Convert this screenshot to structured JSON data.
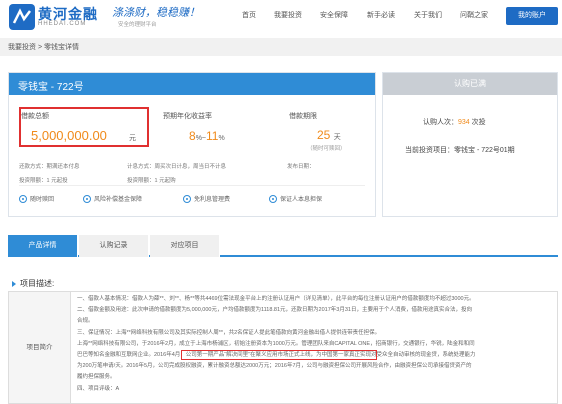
{
  "header": {
    "logo_cn": "黄河金融",
    "logo_en": "HHEDAI.COM",
    "slogan": "涤涤财，稳稳赚！",
    "slogan_sub": "安全的理财平台",
    "nav": [
      "首页",
      "我要投资",
      "安全保障",
      "新手必读",
      "关于我们",
      "问鞘之家"
    ],
    "account_button": "我的账户"
  },
  "breadcrumb": "我要投资 > 零钱宝详情",
  "product": {
    "title": "零钱宝 - 722号",
    "amount_label": "借款总额",
    "amount": "5,000,000.00",
    "amount_unit": "元",
    "rate_label": "预期年化收益率",
    "rate_min": "8",
    "rate_max": "11",
    "rate_sep": "%~",
    "rate_unit": "%",
    "term_label": "借款期限",
    "term_value": "25",
    "term_unit": "天",
    "term_note": "（随时可赎回）",
    "meta": {
      "return_method": "还款方式：期满还本付息",
      "interest_method": "计息方式：周买次日计息，周当日不计息",
      "publish_time": "发布日期：",
      "min_invest": "投资限额：1 元起投",
      "invest_limit": "投资限额：1 元起购"
    },
    "features": [
      "随时赎回",
      "风险补偿基金保障",
      "免利息管理费",
      "保证人本息担保"
    ]
  },
  "side_panel": {
    "status": "认购已满",
    "buyers_prefix": "认购人次：",
    "buyers_count": "934",
    "buyers_suffix": " 次投",
    "project_line": "当前投资项目：零钱宝 - 722号01期"
  },
  "tabs": [
    "产品详情",
    "认购记录",
    "对应项目"
  ],
  "description": {
    "title": "项目描述:",
    "label": "项目简介",
    "lines": [
      "一、借款人基本情况：借款人为薛**、刘**、杨**等共4469位需法现金平台上的注册认证用户（详见清单），此平台的每位注册认证用户的借款额度均不超过3000元。",
      "二、借款金额及用途：此次申请的借款额度为5,000,000元，户均借款额度为1118.81元，还款日期为2017年3月31日，主要用于个人消费，借款用途真实合法，投向",
      "合规。",
      "三、保证情况：上海**网络科技有限公司及其实际控制人周**，共2名保证人提此笔借款向黄河金融出借人提供连带责任担保。",
      "上海**网络科技有限公司，于2016年2月，成立于上海市杨浦区，初始注册资本为1000万元。管理团队来自CAPITAL ONE，招商银行，交通银行，华锐，陆金和和同",
      "巴巴等知名金融和互联网企业。2016年4月，公司第一期产品“解决间里”在聚义应用市场正式上线，为中国第一家真正实现对受众全自动审核的现金贷，系统处理能力",
      "为200万笔申请/天。2016年5月，公司完成股权融资，累计融资总额达2000万元；2016年7月，公司与融资担保公司开展风险合作，由融资担保公司承接借贷资产的",
      "履约担保服务。",
      "四、项目评级：A"
    ]
  }
}
